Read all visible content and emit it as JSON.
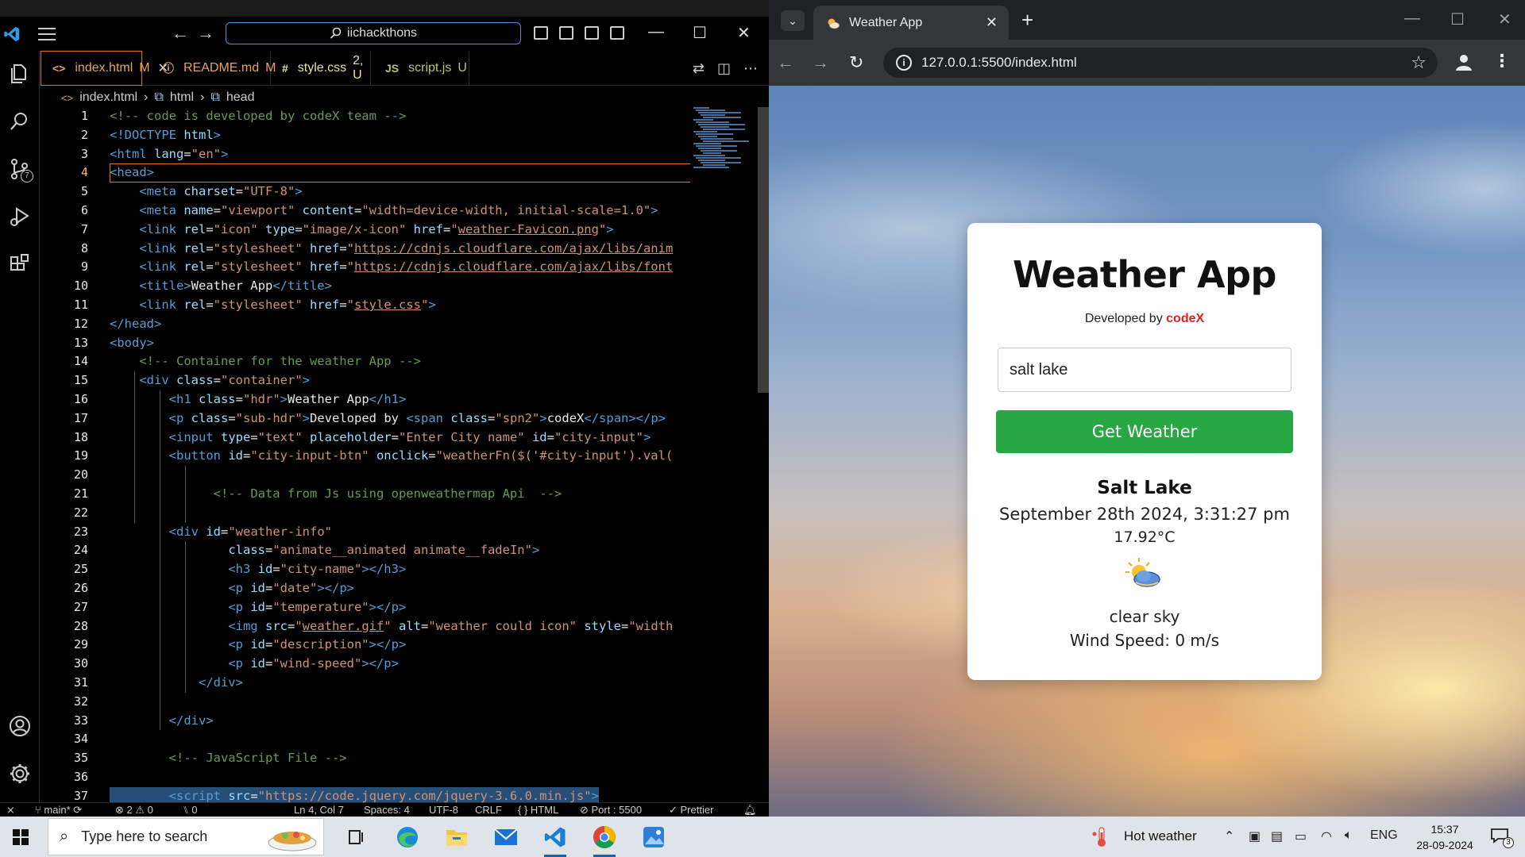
{
  "vscode": {
    "command_center": "iichackthons",
    "tabs": [
      {
        "name": "index.html",
        "status": "M",
        "icon": "<>",
        "color": "#e8a35a",
        "active": true
      },
      {
        "name": "README.md",
        "status": "M",
        "icon": "ⓘ",
        "color": "#e8a35a"
      },
      {
        "name": "style.css",
        "status": "2, U",
        "icon": "#",
        "color": "#e8e0a0"
      },
      {
        "name": "script.js",
        "status": "U",
        "icon": "JS",
        "color": "#b5c96a"
      }
    ],
    "breadcrumb": [
      "index.html",
      "html",
      "head"
    ],
    "scm_badge": "7",
    "line_numbers": [
      "1",
      "2",
      "3",
      "4",
      "5",
      "6",
      "7",
      "8",
      "9",
      "10",
      "11",
      "12",
      "13",
      "14",
      "15",
      "16",
      "17",
      "18",
      "19",
      "20",
      "21",
      "22",
      "23",
      "24",
      "25",
      "26",
      "27",
      "28",
      "29",
      "30",
      "31",
      "32",
      "33",
      "34",
      "35",
      "36",
      "37"
    ],
    "current_line": 4,
    "code": [
      [
        [
          "cm",
          "<!-- code is developed by codeX team -->"
        ]
      ],
      [
        [
          "tg",
          "<!DOCTYPE "
        ],
        [
          "at",
          "html"
        ],
        [
          "tg",
          ">"
        ]
      ],
      [
        [
          "tg",
          "<html "
        ],
        [
          "at",
          "lang"
        ],
        [
          "tx",
          "="
        ],
        [
          "st",
          "\"en\""
        ],
        [
          "tg",
          ">"
        ]
      ],
      [
        [
          "tg",
          "<head>"
        ]
      ],
      [
        [
          "tx",
          "    "
        ],
        [
          "tg",
          "<meta "
        ],
        [
          "at",
          "charset"
        ],
        [
          "tx",
          "="
        ],
        [
          "st",
          "\"UTF-8\""
        ],
        [
          "tg",
          ">"
        ]
      ],
      [
        [
          "tx",
          "    "
        ],
        [
          "tg",
          "<meta "
        ],
        [
          "at",
          "name"
        ],
        [
          "tx",
          "="
        ],
        [
          "st",
          "\"viewport\" "
        ],
        [
          "at",
          "content"
        ],
        [
          "tx",
          "="
        ],
        [
          "st",
          "\"width=device-width, initial-scale=1.0\""
        ],
        [
          "tg",
          ">"
        ]
      ],
      [
        [
          "tx",
          "    "
        ],
        [
          "tg",
          "<link "
        ],
        [
          "at",
          "rel"
        ],
        [
          "tx",
          "="
        ],
        [
          "st",
          "\"icon\" "
        ],
        [
          "at",
          "type"
        ],
        [
          "tx",
          "="
        ],
        [
          "st",
          "\"image/x-icon\" "
        ],
        [
          "at",
          "href"
        ],
        [
          "tx",
          "="
        ],
        [
          "st",
          "\""
        ],
        [
          "stu",
          "weather-Favicon.png"
        ],
        [
          "st",
          "\""
        ],
        [
          "tg",
          ">"
        ]
      ],
      [
        [
          "tx",
          "    "
        ],
        [
          "tg",
          "<link "
        ],
        [
          "at",
          "rel"
        ],
        [
          "tx",
          "="
        ],
        [
          "st",
          "\"stylesheet\" "
        ],
        [
          "at",
          "href"
        ],
        [
          "tx",
          "="
        ],
        [
          "st",
          "\""
        ],
        [
          "stu",
          "https://cdnjs.cloudflare.com/ajax/libs/anim"
        ]
      ],
      [
        [
          "tx",
          "    "
        ],
        [
          "tg",
          "<link "
        ],
        [
          "at",
          "rel"
        ],
        [
          "tx",
          "="
        ],
        [
          "st",
          "\"stylesheet\" "
        ],
        [
          "at",
          "href"
        ],
        [
          "tx",
          "="
        ],
        [
          "st",
          "\""
        ],
        [
          "stu",
          "https://cdnjs.cloudflare.com/ajax/libs/font"
        ]
      ],
      [
        [
          "tx",
          "    "
        ],
        [
          "tg",
          "<title>"
        ],
        [
          "tx",
          "Weather App"
        ],
        [
          "tg",
          "</title>"
        ]
      ],
      [
        [
          "tx",
          "    "
        ],
        [
          "tg",
          "<link "
        ],
        [
          "at",
          "rel"
        ],
        [
          "tx",
          "="
        ],
        [
          "st",
          "\"stylesheet\" "
        ],
        [
          "at",
          "href"
        ],
        [
          "tx",
          "="
        ],
        [
          "st",
          "\""
        ],
        [
          "stu",
          "style.css"
        ],
        [
          "st",
          "\""
        ],
        [
          "tg",
          ">"
        ]
      ],
      [
        [
          "tg",
          "</head>"
        ]
      ],
      [
        [
          "tg",
          "<body>"
        ]
      ],
      [
        [
          "tx",
          "    "
        ],
        [
          "cm",
          "<!-- Container for the weather App -->"
        ]
      ],
      [
        [
          "tx",
          "    "
        ],
        [
          "tg",
          "<div "
        ],
        [
          "at",
          "class"
        ],
        [
          "tx",
          "="
        ],
        [
          "st",
          "\"container\""
        ],
        [
          "tg",
          ">"
        ]
      ],
      [
        [
          "tx",
          "        "
        ],
        [
          "tg",
          "<h1 "
        ],
        [
          "at",
          "class"
        ],
        [
          "tx",
          "="
        ],
        [
          "st",
          "\"hdr\""
        ],
        [
          "tg",
          ">"
        ],
        [
          "tx",
          "Weather App"
        ],
        [
          "tg",
          "</h1>"
        ]
      ],
      [
        [
          "tx",
          "        "
        ],
        [
          "tg",
          "<p "
        ],
        [
          "at",
          "class"
        ],
        [
          "tx",
          "="
        ],
        [
          "st",
          "\"sub-hdr\""
        ],
        [
          "tg",
          ">"
        ],
        [
          "tx",
          "Developed by "
        ],
        [
          "tg",
          "<span "
        ],
        [
          "at",
          "class"
        ],
        [
          "tx",
          "="
        ],
        [
          "st",
          "\"spn2\""
        ],
        [
          "tg",
          ">"
        ],
        [
          "tx",
          "codeX"
        ],
        [
          "tg",
          "</span></p>"
        ]
      ],
      [
        [
          "tx",
          "        "
        ],
        [
          "tg",
          "<input "
        ],
        [
          "at",
          "type"
        ],
        [
          "tx",
          "="
        ],
        [
          "st",
          "\"text\" "
        ],
        [
          "at",
          "placeholder"
        ],
        [
          "tx",
          "="
        ],
        [
          "st",
          "\"Enter City name\" "
        ],
        [
          "at",
          "id"
        ],
        [
          "tx",
          "="
        ],
        [
          "st",
          "\"city-input\""
        ],
        [
          "tg",
          ">"
        ]
      ],
      [
        [
          "tx",
          "        "
        ],
        [
          "tg",
          "<button "
        ],
        [
          "at",
          "id"
        ],
        [
          "tx",
          "="
        ],
        [
          "st",
          "\"city-input-btn\" "
        ],
        [
          "at",
          "onclick"
        ],
        [
          "tx",
          "="
        ],
        [
          "st",
          "\"weatherFn($('#city-input').val("
        ]
      ],
      [],
      [
        [
          "tx",
          "              "
        ],
        [
          "cm",
          "<!-- Data from Js using openweathermap Api  -->"
        ]
      ],
      [],
      [
        [
          "tx",
          "        "
        ],
        [
          "tg",
          "<div "
        ],
        [
          "at",
          "id"
        ],
        [
          "tx",
          "="
        ],
        [
          "st",
          "\"weather-info\""
        ]
      ],
      [
        [
          "tx",
          "                "
        ],
        [
          "at",
          "class"
        ],
        [
          "tx",
          "="
        ],
        [
          "st",
          "\"animate__animated animate__fadeIn\""
        ],
        [
          "tg",
          ">"
        ]
      ],
      [
        [
          "tx",
          "                "
        ],
        [
          "tg",
          "<h3 "
        ],
        [
          "at",
          "id"
        ],
        [
          "tx",
          "="
        ],
        [
          "st",
          "\"city-name\""
        ],
        [
          "tg",
          "></h3>"
        ]
      ],
      [
        [
          "tx",
          "                "
        ],
        [
          "tg",
          "<p "
        ],
        [
          "at",
          "id"
        ],
        [
          "tx",
          "="
        ],
        [
          "st",
          "\"date\""
        ],
        [
          "tg",
          "></p>"
        ]
      ],
      [
        [
          "tx",
          "                "
        ],
        [
          "tg",
          "<p "
        ],
        [
          "at",
          "id"
        ],
        [
          "tx",
          "="
        ],
        [
          "st",
          "\"temperature\""
        ],
        [
          "tg",
          "></p>"
        ]
      ],
      [
        [
          "tx",
          "                "
        ],
        [
          "tg",
          "<img "
        ],
        [
          "at",
          "src"
        ],
        [
          "tx",
          "="
        ],
        [
          "st",
          "\""
        ],
        [
          "stu",
          "weather.gif"
        ],
        [
          "st",
          "\" "
        ],
        [
          "at",
          "alt"
        ],
        [
          "tx",
          "="
        ],
        [
          "st",
          "\"weather could icon\" "
        ],
        [
          "at",
          "style"
        ],
        [
          "tx",
          "="
        ],
        [
          "st",
          "\"width"
        ]
      ],
      [
        [
          "tx",
          "                "
        ],
        [
          "tg",
          "<p "
        ],
        [
          "at",
          "id"
        ],
        [
          "tx",
          "="
        ],
        [
          "st",
          "\"description\""
        ],
        [
          "tg",
          "></p>"
        ]
      ],
      [
        [
          "tx",
          "                "
        ],
        [
          "tg",
          "<p "
        ],
        [
          "at",
          "id"
        ],
        [
          "tx",
          "="
        ],
        [
          "st",
          "\"wind-speed\""
        ],
        [
          "tg",
          "></p>"
        ]
      ],
      [
        [
          "tx",
          "            "
        ],
        [
          "tg",
          "</div>"
        ]
      ],
      [],
      [
        [
          "tx",
          "        "
        ],
        [
          "tg",
          "</div>"
        ]
      ],
      [],
      [
        [
          "tx",
          "        "
        ],
        [
          "cm",
          "<!-- JavaScript File -->"
        ]
      ],
      [],
      [
        [
          "tx",
          "        "
        ],
        [
          "tg",
          "<script "
        ],
        [
          "at",
          "src"
        ],
        [
          "tx",
          "="
        ],
        [
          "st",
          "\"https://code.jquery.com/jquery-3.6.0.min.js\""
        ],
        [
          "tg",
          ">"
        ]
      ]
    ],
    "status": {
      "branch": "main*",
      "problems": "⊗ 2 ⚠ 0",
      "ports": "⑊ 0",
      "cursor": "Ln 4, Col 7",
      "spaces": "Spaces: 4",
      "encoding": "UTF-8",
      "eol": "CRLF",
      "language": "{ } HTML",
      "port": "⊘ Port : 5500",
      "prettier": "✓ Prettier"
    }
  },
  "chrome": {
    "tab_title": "Weather App",
    "url": "127.0.0.1:5500/index.html"
  },
  "app": {
    "title": "Weather App",
    "subtitle_prefix": "Developed by",
    "subtitle_brand": "codeX",
    "input_value": "salt lake",
    "input_placeholder": "Enter City name",
    "button_label": "Get Weather",
    "city": "Salt Lake",
    "date": "September 28th 2024, 3:31:27 pm",
    "temperature": "17.92°C",
    "description": "clear sky",
    "wind": "Wind Speed: 0 m/s"
  },
  "taskbar": {
    "search_placeholder": "Type here to search",
    "weather": "Hot weather",
    "language": "ENG",
    "time": "15:37",
    "date": "28-09-2024",
    "notifications": "3"
  }
}
